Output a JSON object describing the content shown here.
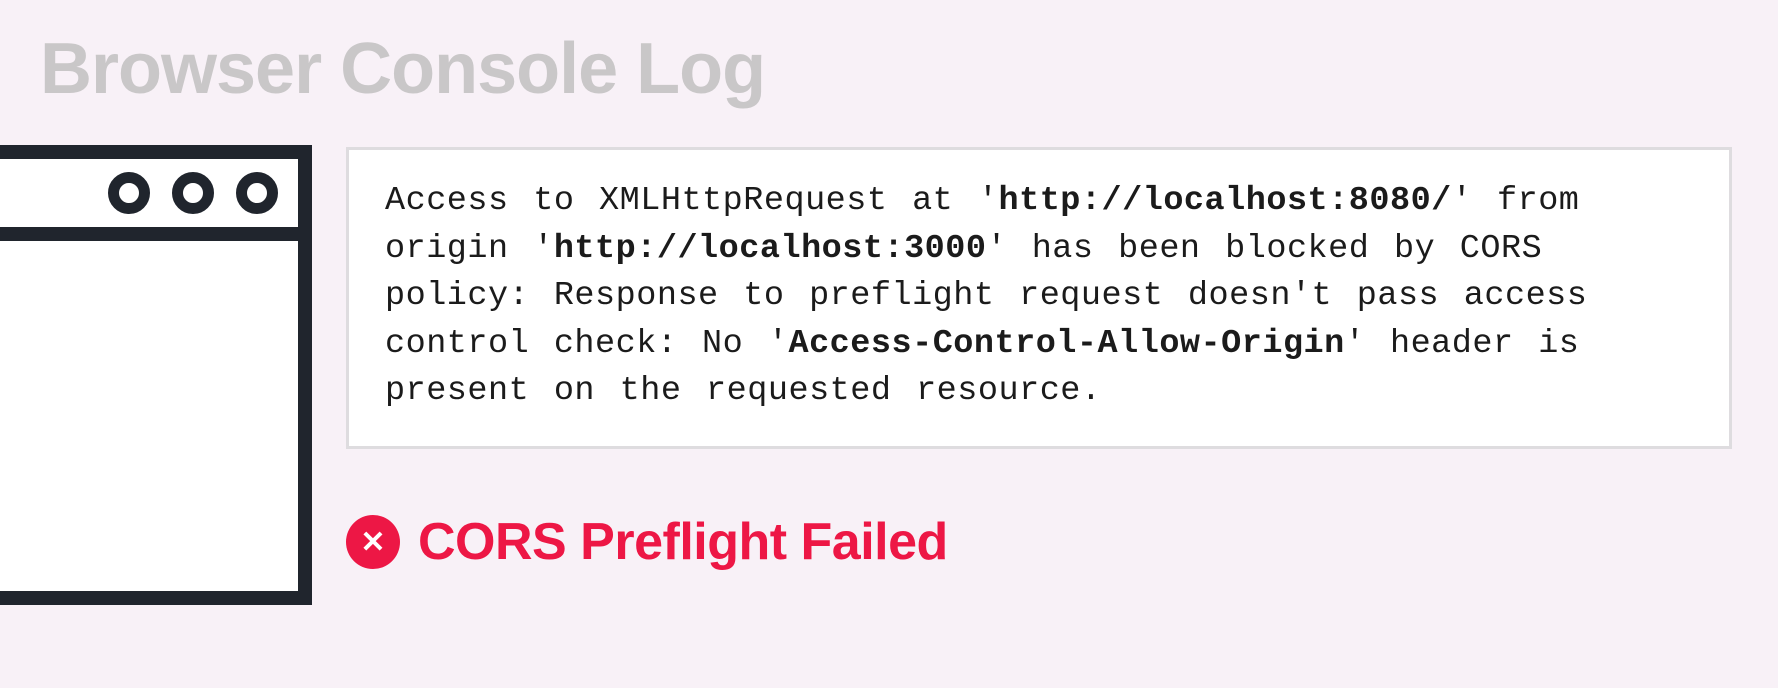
{
  "title": "Browser Console Log",
  "log": {
    "prefix1": "Access to XMLHttpRequest at '",
    "url1": "http://localhost:8080/",
    "mid1": "' from origin '",
    "url2": "http://localhost:3000",
    "mid2": "' has been blocked by CORS policy: Response to preflight request doesn't pass access control check: No '",
    "header": "Access-Control-Allow-Origin",
    "suffix": "' header is present on the requested resource."
  },
  "status": {
    "icon_glyph": "✕",
    "label": "CORS Preflight Failed"
  }
}
